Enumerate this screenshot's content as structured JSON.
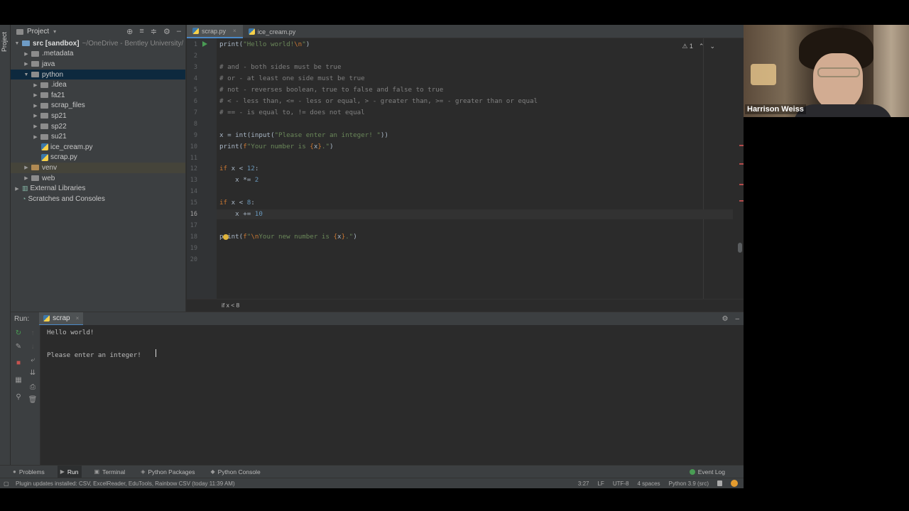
{
  "project_panel": {
    "title": "Project",
    "tree": [
      {
        "label": "src [sandbox]",
        "note": "~/OneDrive - Bentley University/",
        "indent": 0,
        "type": "folder",
        "expanded": true
      },
      {
        "label": ".metadata",
        "indent": 1,
        "type": "folder"
      },
      {
        "label": "java",
        "indent": 1,
        "type": "folder"
      },
      {
        "label": "python",
        "indent": 1,
        "type": "folder",
        "expanded": true,
        "selected": true
      },
      {
        "label": ".idea",
        "indent": 2,
        "type": "folder"
      },
      {
        "label": "fa21",
        "indent": 2,
        "type": "folder"
      },
      {
        "label": "scrap_files",
        "indent": 2,
        "type": "folder"
      },
      {
        "label": "sp21",
        "indent": 2,
        "type": "folder"
      },
      {
        "label": "sp22",
        "indent": 2,
        "type": "folder"
      },
      {
        "label": "su21",
        "indent": 2,
        "type": "folder"
      },
      {
        "label": "ice_cream.py",
        "indent": 2,
        "type": "py"
      },
      {
        "label": "scrap.py",
        "indent": 2,
        "type": "py"
      },
      {
        "label": "venv",
        "indent": 1,
        "type": "folder-orange",
        "highlight": true
      },
      {
        "label": "web",
        "indent": 1,
        "type": "folder"
      },
      {
        "label": "External Libraries",
        "indent": 0,
        "type": "lib"
      },
      {
        "label": "Scratches and Consoles",
        "indent": 0,
        "type": "scratch"
      }
    ]
  },
  "side_tab": "Project",
  "editor_tabs": [
    {
      "label": "scrap.py",
      "active": true
    },
    {
      "label": "ice_cream.py",
      "active": false
    }
  ],
  "inspection": {
    "warning_count": "1"
  },
  "code_lines": [
    {
      "n": "1",
      "html": "<span class='fn'>print</span>(<span class='str'>\"Hello world!<span class='esc'>\\n</span>\"</span>)"
    },
    {
      "n": "2",
      "html": ""
    },
    {
      "n": "3",
      "html": "<span class='cm'># and - both sides must be true</span>"
    },
    {
      "n": "4",
      "html": "<span class='cm'># or - at least one side must be true</span>"
    },
    {
      "n": "5",
      "html": "<span class='cm'># not - reverses boolean, true to false and false to true</span>"
    },
    {
      "n": "6",
      "html": "<span class='cm'># &lt; - less than, &lt;= - less or equal, &gt; - greater than, &gt;= - greater than or equal</span>"
    },
    {
      "n": "7",
      "html": "<span class='cm'># == - is equal to, != does not equal</span>"
    },
    {
      "n": "8",
      "html": ""
    },
    {
      "n": "9",
      "html": "x = <span class='fn'>int</span>(<span class='fn'>input</span>(<span class='str'>\"Please enter an integer! \"</span>))"
    },
    {
      "n": "10",
      "html": "<span class='fn'>print</span>(<span class='kw'>f</span><span class='str'>\"Your number is </span><span class='esc'>{</span>x<span class='esc'>}</span><span class='str'>.\"</span>)"
    },
    {
      "n": "11",
      "html": ""
    },
    {
      "n": "12",
      "html": "<span class='kw'>if</span> x &lt; <span class='num'>12</span>:"
    },
    {
      "n": "13",
      "html": "    x *= <span class='num'>2</span>"
    },
    {
      "n": "14",
      "html": ""
    },
    {
      "n": "15",
      "html": "<span class='kw'>if</span> x &lt; <span class='num'>8</span>:"
    },
    {
      "n": "16",
      "html": "    x += <span class='num'>10</span>"
    },
    {
      "n": "17",
      "html": ""
    },
    {
      "n": "18",
      "html": "<span class='fn'>print</span>(<span class='kw'>f</span><span class='str'>\"<span class='esc'>\\n</span>Your new number is </span><span class='esc'>{</span>x<span class='esc'>}</span><span class='str'>.\"</span>)"
    },
    {
      "n": "19",
      "html": ""
    },
    {
      "n": "20",
      "html": ""
    }
  ],
  "current_line": "16",
  "breadcrumb": "if x < 8",
  "run_panel": {
    "label": "Run:",
    "tab": "scrap",
    "output": [
      "Hello world!",
      "",
      "Please enter an integer!  "
    ]
  },
  "tool_windows": [
    {
      "label": "Problems",
      "icon": "problems-icon"
    },
    {
      "label": "Run",
      "icon": "run-icon",
      "active": true
    },
    {
      "label": "Terminal",
      "icon": "terminal-icon"
    },
    {
      "label": "Python Packages",
      "icon": "packages-icon"
    },
    {
      "label": "Python Console",
      "icon": "python-console-icon"
    }
  ],
  "event_log": "Event Log",
  "status": {
    "message": "Plugin updates installed: CSV, ExcelReader, EduTools, Rainbow CSV (today 11:39 AM)",
    "position": "3:27",
    "line_sep": "LF",
    "encoding": "UTF-8",
    "indent": "4 spaces",
    "interpreter": "Python 3.9 (src)"
  },
  "webcam": {
    "name": "Harrison Weiss"
  }
}
